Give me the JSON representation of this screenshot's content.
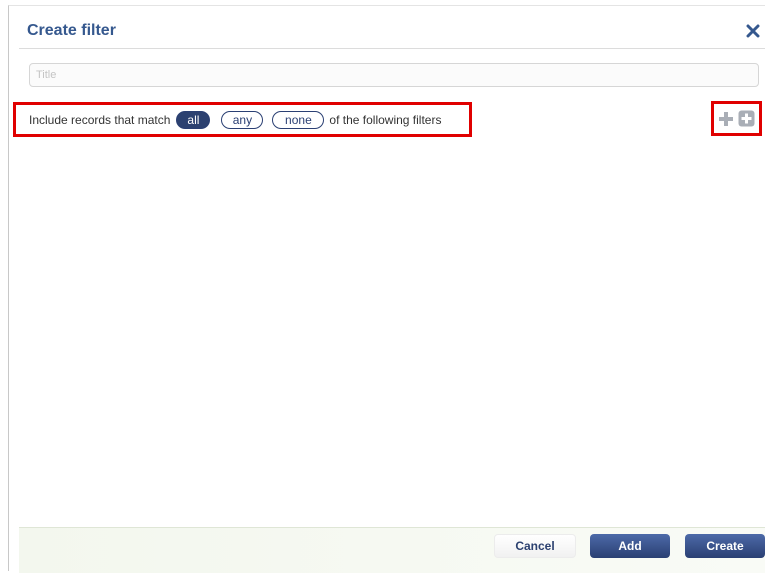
{
  "dialog": {
    "title": "Create filter",
    "close_icon": "close-icon"
  },
  "title_field": {
    "placeholder": "Title",
    "value": ""
  },
  "match": {
    "prefix": "Include records that match",
    "options": [
      "all",
      "any",
      "none"
    ],
    "selected": "all",
    "suffix": "of the following filters"
  },
  "add_controls": {
    "add_filter_icon": "plus-icon",
    "add_group_icon": "plus-square-icon"
  },
  "footer": {
    "cancel_label": "Cancel",
    "add_label": "Add",
    "create_label": "Create"
  },
  "colors": {
    "title": "#35588e",
    "primary_button": "#2c4170",
    "highlight_border": "#e00000",
    "icon_gray": "#a9aeb6"
  }
}
